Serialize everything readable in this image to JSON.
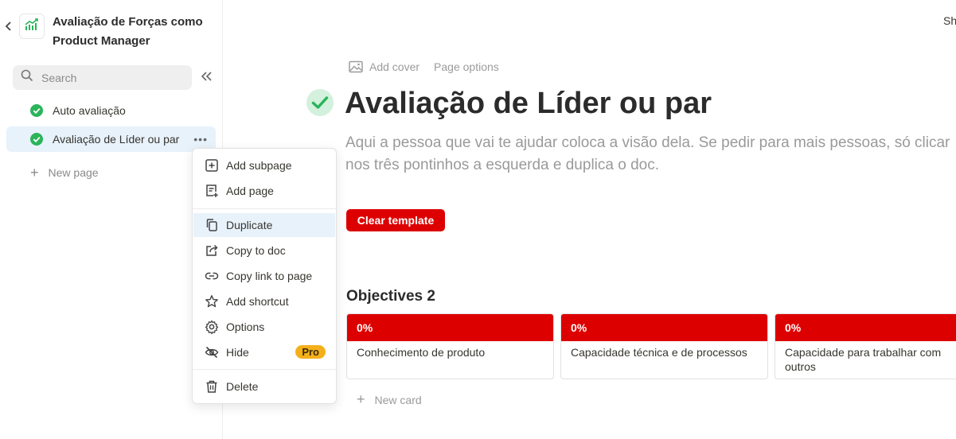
{
  "sidebar": {
    "doc_title": "Avaliação de Forças como Product Manager",
    "search_placeholder": "Search",
    "pages": [
      {
        "label": "Auto avaliação",
        "active": false
      },
      {
        "label": "Avaliação de Líder ou par",
        "active": true
      }
    ],
    "more_label": "•••",
    "new_page_label": "New page",
    "icons": {
      "back": "chevron-left-icon",
      "logo": "growth-chart-icon",
      "search": "search-icon",
      "collapse": "double-chevron-left-icon",
      "page": "check-circle-icon"
    }
  },
  "context_menu": {
    "items": [
      {
        "label": "Add subpage",
        "icon": "add-square-icon"
      },
      {
        "label": "Add page",
        "icon": "add-page-icon"
      },
      {
        "label": "Duplicate",
        "icon": "duplicate-icon",
        "highlighted": true
      },
      {
        "label": "Copy to doc",
        "icon": "share-out-icon"
      },
      {
        "label": "Copy link to page",
        "icon": "link-icon"
      },
      {
        "label": "Add shortcut",
        "icon": "star-icon"
      },
      {
        "label": "Options",
        "icon": "gear-icon"
      },
      {
        "label": "Hide",
        "icon": "eye-off-icon",
        "badge": "Pro"
      },
      {
        "label": "Delete",
        "icon": "trash-icon"
      }
    ],
    "pro_badge_color": "#f4b01b"
  },
  "topbar": {
    "share_label": "Sh"
  },
  "main": {
    "add_cover_label": "Add cover",
    "page_options_label": "Page options",
    "title": "Avaliação de Líder ou par",
    "subtitle": "Aqui a pessoa que vai te ajudar coloca a visão dela. Se pedir para mais pessoas, só clicar nos três pontinhos a esquerda e duplica o doc.",
    "clear_template_label": "Clear template",
    "section_title": "Objectives 2",
    "cards": [
      {
        "progress": "0%",
        "text": "Conhecimento de produto"
      },
      {
        "progress": "0%",
        "text": "Capacidade técnica e de processos"
      },
      {
        "progress": "0%",
        "text": "Capacidade para trabalhar com outros"
      }
    ],
    "new_card_label": "New card"
  },
  "colors": {
    "accent_red": "#dd0000",
    "check_green": "#2bb45a",
    "active_blue": "#e8f2fb"
  }
}
